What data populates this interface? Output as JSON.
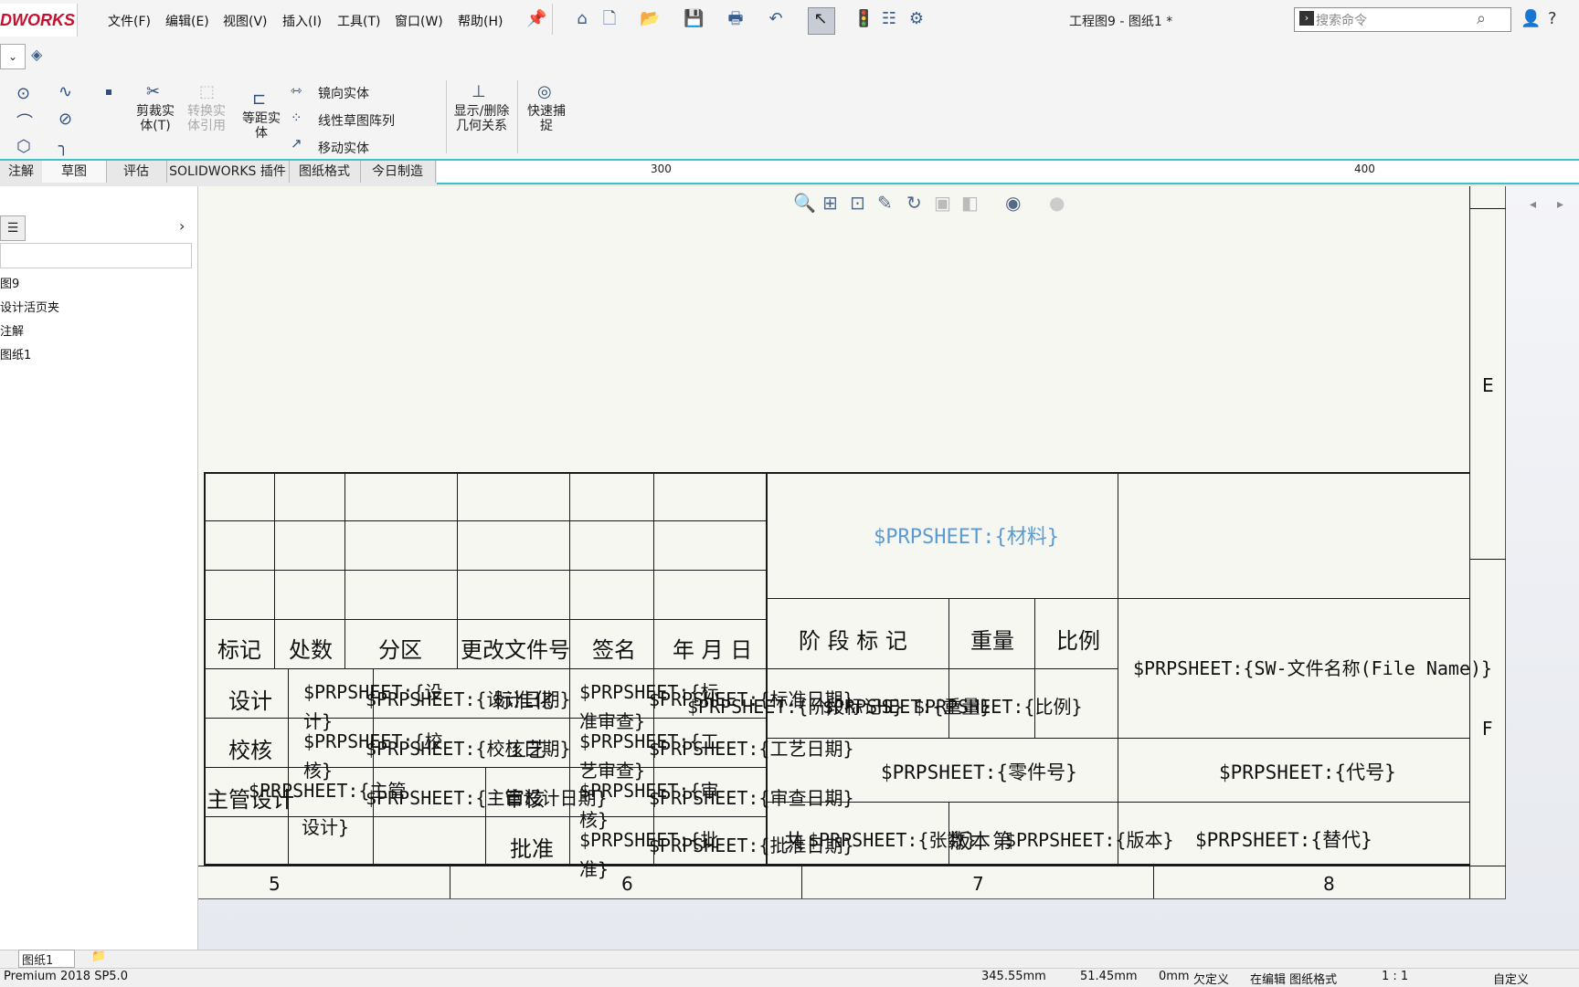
{
  "app": {
    "logo": "DWORKS",
    "doc_title": "工程图9 - 图纸1 *"
  },
  "menu": [
    "文件(F)",
    "编辑(E)",
    "视图(V)",
    "插入(I)",
    "工具(T)",
    "窗口(W)",
    "帮助(H)"
  ],
  "search": {
    "placeholder": "搜索命令"
  },
  "ribbon": {
    "trim": "剪裁实体(T)",
    "convert": "转换实体引用",
    "offset": "等距实体",
    "mirror": "镜向实体",
    "linear_pattern": "线性草图阵列",
    "move": "移动实体",
    "show_delete": "显示/删除几何关系",
    "quick_snap": "快速捕捉"
  },
  "tabs": [
    "注解",
    "草图",
    "评估",
    "SOLIDWORKS 插件",
    "图纸格式",
    "今日制造"
  ],
  "ruler": {
    "a": "300",
    "b": "400"
  },
  "tree": [
    "图9",
    "设计活页夹",
    "注解",
    "图纸1"
  ],
  "title_block": {
    "headers": [
      "标记",
      "处数",
      "分区",
      "更改文件号",
      "签名",
      "年 月 日"
    ],
    "material": "$PRPSHEET:{材料}",
    "stage": "阶 段 标 记",
    "weight": "重量",
    "scale": "比例",
    "filename": "$PRPSHEET:{SW-文件名称(File Name)}",
    "design": "设计",
    "check": "校核",
    "chief": "主管设计",
    "approve": "批准",
    "part_no": "$PRPSHEET:{零件号}",
    "code": "$PRPSHEET:{代号}",
    "replace": "$PRPSHEET:{替代}",
    "p_design1": "$PRPSHEET:{设",
    "p_design2": "计}",
    "p_design_std": "$PRPSHEET:{设计日期}",
    "p_standard": "标准化",
    "p_std1": "$PRPSHEET:{标",
    "p_std2": "准审查}",
    "p_std_date": "$PRPSHEET:{标准日期}",
    "p_check1": "$PRPSHEET:{校",
    "p_check2": "核}",
    "p_check_date": "$PRPSHEET:{校核日期}",
    "p_process": "工艺",
    "p_proc1": "$PRPSHEET:{工",
    "p_proc2": "艺审查}",
    "p_proc_date": "$PRPSHEET:{工艺日期}",
    "p_chief1": "$PRPSHEET:{主管",
    "p_chief2": "设计}",
    "p_chief_date": "$PRPSHEET:{主管设计日期}",
    "p_review": "审核",
    "p_rev1": "$PRPSHEET:{审",
    "p_rev2": "核}",
    "p_rev_date": "$PRPSHEET:{审查日期}",
    "p_appr1": "$PRPSHEET:{批",
    "p_appr2": "准}",
    "p_appr_date": "$PRPSHEET:{批准日期}",
    "p_stage": "$PRPSHEET:{阶段标记S}",
    "p_weight": "$PRPSHEET:{重量}",
    "p_scale": "$PRPSHEET:{比例}",
    "p_total": "共",
    "p_sheet": "$PRPSHEET:{张数}",
    "p_ver": "版本",
    "p_page": "第",
    "p_material2": "$PRPSHEET:{版本}"
  },
  "zones_bottom": [
    "5",
    "6",
    "7",
    "8"
  ],
  "zones_right": [
    "E",
    "F"
  ],
  "sheet_tab": "图纸1",
  "status": {
    "edition": "Premium 2018 SP5.0",
    "x": "345.55mm",
    "y": "51.45mm",
    "z": "0mm",
    "state": "欠定义",
    "editing": "在编辑 图纸格式",
    "ratio": "1 : 1",
    "custom": "自定义"
  }
}
